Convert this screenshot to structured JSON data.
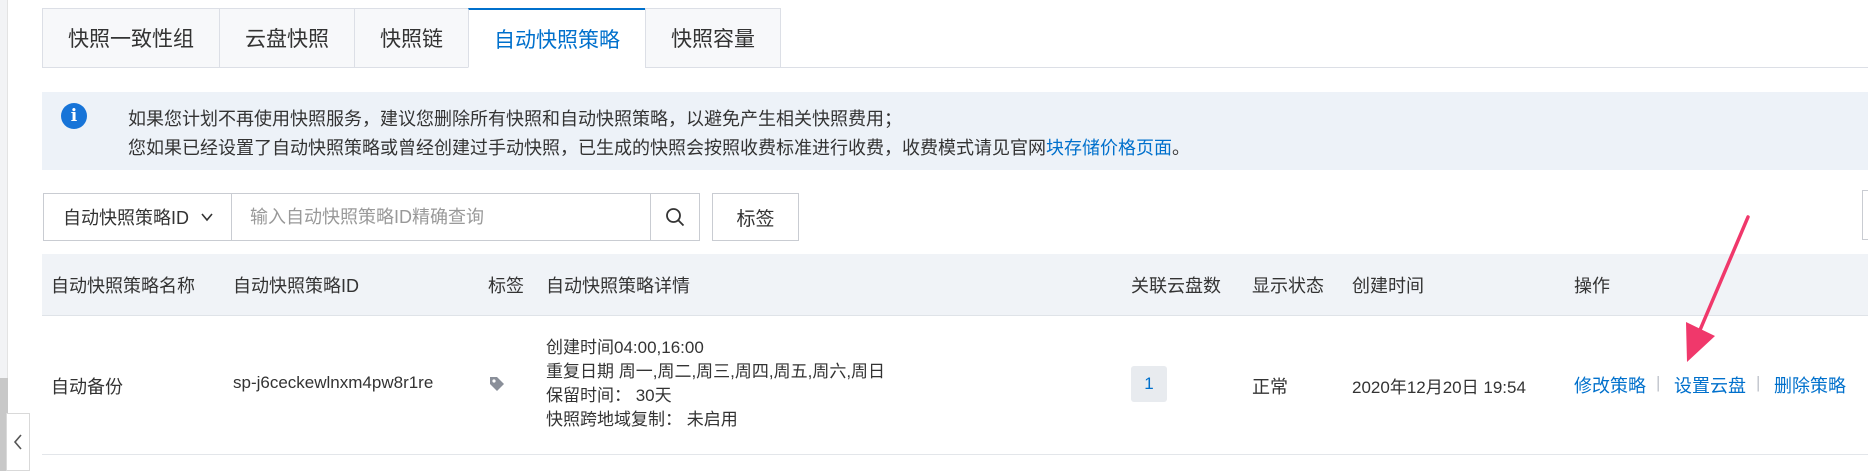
{
  "tabs": [
    {
      "label": "快照一致性组",
      "active": false
    },
    {
      "label": "云盘快照",
      "active": false
    },
    {
      "label": "快照链",
      "active": false
    },
    {
      "label": "自动快照策略",
      "active": true
    },
    {
      "label": "快照容量",
      "active": false
    }
  ],
  "notice": {
    "line1": "如果您计划不再使用快照服务，建议您删除所有快照和自动快照策略，以避免产生相关快照费用；",
    "line2_prefix": "您如果已经设置了自动快照策略或曾经创建过手动快照，已生成的快照会按照收费标准进行收费，收费模式请见官网",
    "line2_link": "块存储价格页面",
    "line2_suffix": "。",
    "icon": "info-icon"
  },
  "search": {
    "select_value": "自动快照策略ID",
    "placeholder": "输入自动快照策略ID精确查询",
    "tag_button": "标签"
  },
  "table": {
    "headers": {
      "name": "自动快照策略名称",
      "id": "自动快照策略ID",
      "tag": "标签",
      "detail": "自动快照策略详情",
      "disks": "关联云盘数",
      "status": "显示状态",
      "created": "创建时间",
      "ops": "操作"
    },
    "rows": [
      {
        "name": "自动备份",
        "id": "sp-j6ceckewlnxm4pw8r1re",
        "detail": [
          "创建时间04:00,16:00",
          "重复日期 周一,周二,周三,周四,周五,周六,周日",
          "保留时间：  30天",
          "快照跨地域复制：  未启用"
        ],
        "disks": "1",
        "status": "正常",
        "created": "2020年12月20日 19:54",
        "ops": [
          "修改策略",
          "设置云盘",
          "删除策略"
        ],
        "separator": "|"
      }
    ]
  },
  "colors": {
    "accent": "#0070cc",
    "notice_bg": "#edf2f8",
    "header_bg": "#f0f3f7",
    "arrow": "#f0386b"
  }
}
